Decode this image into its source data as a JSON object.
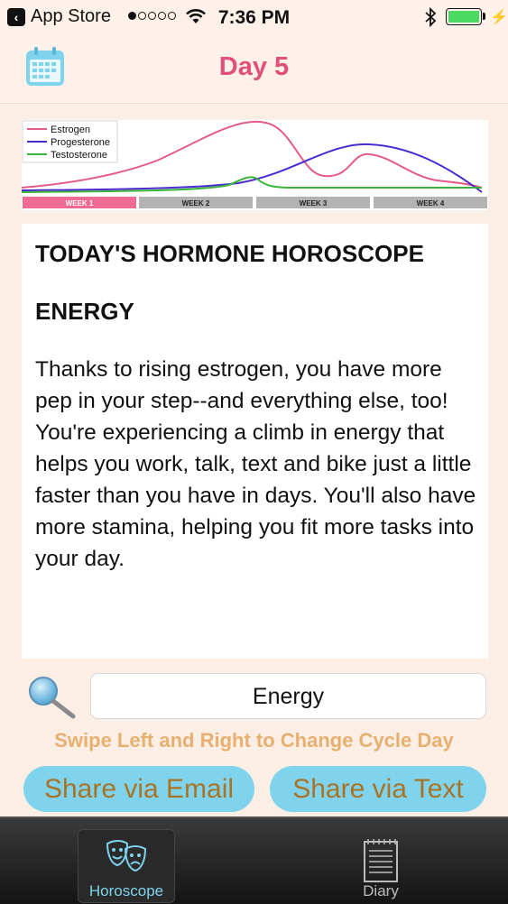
{
  "status_bar": {
    "back_app": "App Store",
    "time": "7:36 PM"
  },
  "nav": {
    "title": "Day 5"
  },
  "chart_data": {
    "type": "line",
    "categories": [
      "WEEK 1",
      "WEEK 2",
      "WEEK 3",
      "WEEK 4"
    ],
    "current_week": "WEEK 1",
    "series": [
      {
        "name": "Estrogen",
        "color": "#e45a8a"
      },
      {
        "name": "Progesterone",
        "color": "#4a2ad0"
      },
      {
        "name": "Testosterone",
        "color": "#3bb43b"
      }
    ]
  },
  "card": {
    "heading": "TODAY'S HORMONE HOROSCOPE",
    "topic": "ENERGY",
    "body": "Thanks to rising estrogen, you have more pep in your step--and everything else, too! You're experiencing a climb in energy that helps you work, talk, text and bike just a little faster than you have in days. You'll also have more stamina, helping you fit more tasks into your day."
  },
  "search": {
    "value": "Energy"
  },
  "hint": "Swipe Left and Right to Change Cycle Day",
  "buttons": {
    "share_email": "Share via Email",
    "share_text": "Share via Text"
  },
  "tabs": [
    {
      "label": "Horoscope",
      "active": true,
      "icon": "drama-masks-icon"
    },
    {
      "label": "Diary",
      "active": false,
      "icon": "notepad-icon"
    }
  ]
}
